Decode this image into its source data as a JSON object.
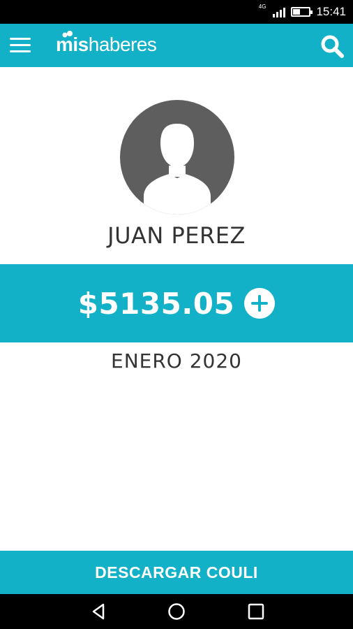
{
  "status_bar": {
    "network": "4G",
    "time": "15:41"
  },
  "app_bar": {
    "logo_bold": "mis",
    "logo_light": "haberes"
  },
  "profile": {
    "name": "JUAN PEREZ"
  },
  "balance": {
    "amount": "$5135.05"
  },
  "period": "ENERO 2020",
  "actions": {
    "download_label": "DESCARGAR COULI"
  },
  "colors": {
    "accent": "#12b1c7",
    "avatar_bg": "#5e5e5e",
    "text": "#333333"
  },
  "icons": [
    "menu-icon",
    "search-icon",
    "plus-icon",
    "avatar-icon",
    "back-icon",
    "home-icon",
    "recents-icon"
  ]
}
